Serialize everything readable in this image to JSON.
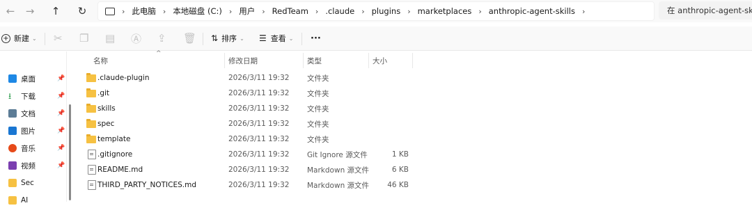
{
  "nav": {
    "back": "←",
    "forward": "→",
    "up": "↑",
    "refresh": "↻"
  },
  "breadcrumb": [
    "此电脑",
    "本地磁盘 (C:)",
    "用户",
    "RedTeam",
    ".claude",
    "plugins",
    "marketplaces",
    "anthropic-agent-skills"
  ],
  "search": {
    "placeholder": "在 anthropic-agent-skills 中搜索"
  },
  "toolbar": {
    "new_label": "新建",
    "sort_label": "排序",
    "view_label": "查看",
    "more_label": "···"
  },
  "sidebar": {
    "items": [
      {
        "label": "桌面",
        "color": "#1e88e5",
        "pinned": true
      },
      {
        "label": "下载",
        "color": "#2e9d4e",
        "pinned": true
      },
      {
        "label": "文档",
        "color": "#5c7c96",
        "pinned": true
      },
      {
        "label": "图片",
        "color": "#1976d2",
        "pinned": true
      },
      {
        "label": "音乐",
        "color": "#e64a19",
        "pinned": true
      },
      {
        "label": "视频",
        "color": "#7b3fb0",
        "pinned": true
      },
      {
        "label": "Sec",
        "color": "#f6c142",
        "pinned": false
      },
      {
        "label": "AI",
        "color": "#f6c142",
        "pinned": false
      }
    ]
  },
  "columns": {
    "name": "名称",
    "modified": "修改日期",
    "type": "类型",
    "size": "大小"
  },
  "files": [
    {
      "name": ".claude-plugin",
      "modified": "2026/3/11 19:32",
      "type": "文件夹",
      "size": "",
      "kind": "folder"
    },
    {
      "name": ".git",
      "modified": "2026/3/11 19:32",
      "type": "文件夹",
      "size": "",
      "kind": "folder"
    },
    {
      "name": "skills",
      "modified": "2026/3/11 19:32",
      "type": "文件夹",
      "size": "",
      "kind": "folder"
    },
    {
      "name": "spec",
      "modified": "2026/3/11 19:32",
      "type": "文件夹",
      "size": "",
      "kind": "folder"
    },
    {
      "name": "template",
      "modified": "2026/3/11 19:32",
      "type": "文件夹",
      "size": "",
      "kind": "folder"
    },
    {
      "name": ".gitignore",
      "modified": "2026/3/11 19:32",
      "type": "Git Ignore 源文件",
      "size": "1 KB",
      "kind": "file"
    },
    {
      "name": "README.md",
      "modified": "2026/3/11 19:32",
      "type": "Markdown 源文件",
      "size": "6 KB",
      "kind": "file"
    },
    {
      "name": "THIRD_PARTY_NOTICES.md",
      "modified": "2026/3/11 19:32",
      "type": "Markdown 源文件",
      "size": "46 KB",
      "kind": "file"
    }
  ]
}
